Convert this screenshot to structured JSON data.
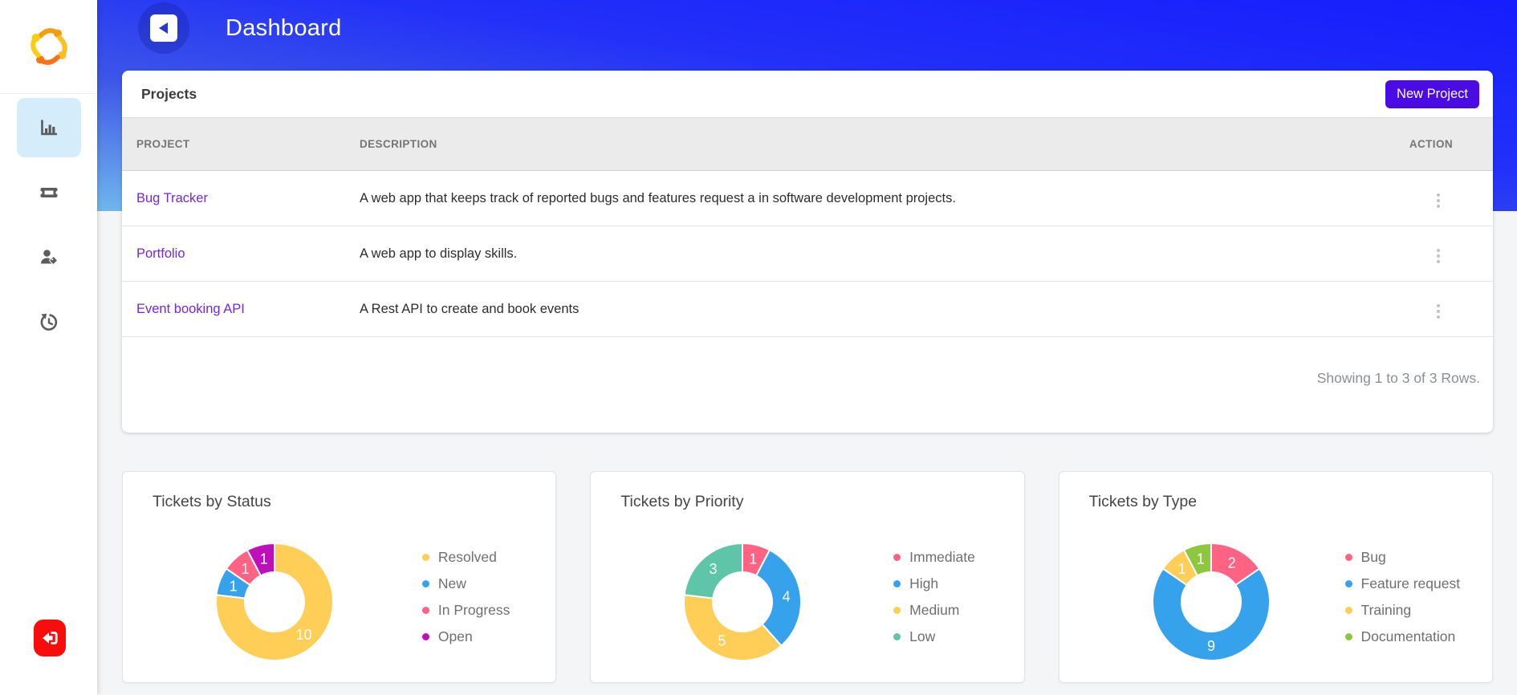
{
  "header": {
    "title": "Dashboard",
    "back_icon": "chevron-left"
  },
  "sidebar": {
    "logo_icon": "team-logo",
    "nav": [
      {
        "name": "dashboard",
        "icon": "bar-chart-icon",
        "active": true
      },
      {
        "name": "tickets",
        "icon": "ticket-icon",
        "active": false
      },
      {
        "name": "users",
        "icon": "user-tag-icon",
        "active": false
      },
      {
        "name": "history",
        "icon": "history-icon",
        "active": false
      }
    ],
    "logout_icon": "sign-out-icon"
  },
  "projects": {
    "title": "Projects",
    "new_button": "New Project",
    "columns": {
      "project": "PROJECT",
      "description": "DESCRIPTION",
      "action": "ACTION"
    },
    "rows": [
      {
        "project": "Bug Tracker",
        "description": "A web app that keeps track of reported bugs and features request a in software development projects."
      },
      {
        "project": "Portfolio",
        "description": "A web app to display skills."
      },
      {
        "project": "Event booking API",
        "description": "A Rest API to create and book events"
      }
    ],
    "action_icon": "vertical-ellipsis-icon",
    "footer": "Showing 1 to 3 of 3 Rows."
  },
  "chart_data": [
    {
      "type": "pie",
      "donut": true,
      "title": "Tickets by Status",
      "labels": [
        "Resolved",
        "New",
        "In Progress",
        "Open"
      ],
      "values": [
        10,
        1,
        1,
        1
      ],
      "colors": [
        "#FFCE56",
        "#36A2EB",
        "#FF6384",
        "#BE10B8"
      ],
      "legend_position": "right",
      "data_labels": "values",
      "start_angle_deg": 0
    },
    {
      "type": "pie",
      "donut": true,
      "title": "Tickets by Priority",
      "labels": [
        "Immediate",
        "High",
        "Medium",
        "Low"
      ],
      "values": [
        1,
        4,
        5,
        3
      ],
      "colors": [
        "#FF6384",
        "#36A2EB",
        "#FFCE56",
        "#5EC5A9"
      ],
      "legend_position": "right",
      "data_labels": "values",
      "start_angle_deg": 0
    },
    {
      "type": "pie",
      "donut": true,
      "title": "Tickets by Type",
      "labels": [
        "Bug",
        "Feature request",
        "Training",
        "Documentation"
      ],
      "values": [
        2,
        9,
        1,
        1
      ],
      "colors": [
        "#FF6384",
        "#36A2EB",
        "#FFCE56",
        "#8DC63F"
      ],
      "legend_position": "right",
      "data_labels": "values",
      "start_angle_deg": 0
    }
  ],
  "colors": {
    "accent_button": "#4A0BE5",
    "link": "#7227E2",
    "header_gradient_light": "#6FB7EC",
    "header_gradient_deep": "#161DFD",
    "sidebar_active_bg": "#D5ECFA",
    "logout_red": "#F80C0C",
    "table_header_bg": "#EBEBEB"
  }
}
